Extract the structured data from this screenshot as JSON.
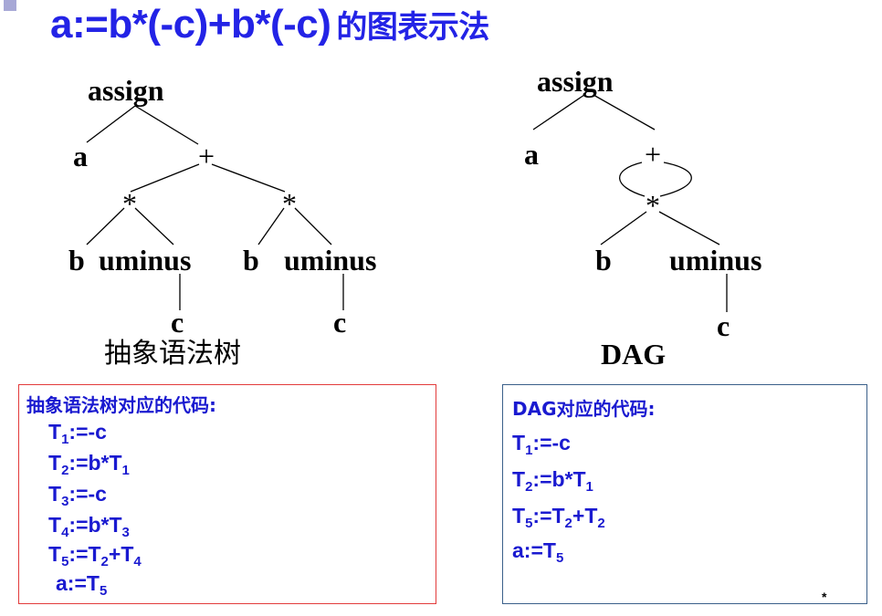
{
  "title": {
    "expr": "a:=b*(-c)+b*(-c)",
    "cn": "的图表示法"
  },
  "ast": {
    "root": "assign",
    "a": "a",
    "plus": "+",
    "star": "*",
    "b": "b",
    "uminus": "uminus",
    "c": "c",
    "caption": "抽象语法树"
  },
  "dag": {
    "root": "assign",
    "a": "a",
    "plus": "+",
    "star": "*",
    "b": "b",
    "uminus": "uminus",
    "c": "c",
    "caption": "DAG"
  },
  "ast_code": {
    "title": "抽象语法树对应的代码:",
    "lines": [
      {
        "pre": "T",
        "sub1": "1",
        "mid": ":=-c",
        "sub2": "",
        "post": "",
        "sub3": ""
      },
      {
        "pre": "T",
        "sub1": "2",
        "mid": ":=b*T",
        "sub2": "1",
        "post": "",
        "sub3": ""
      },
      {
        "pre": "T",
        "sub1": "3",
        "mid": ":=-c",
        "sub2": "",
        "post": "",
        "sub3": ""
      },
      {
        "pre": "T",
        "sub1": "4",
        "mid": ":=b*T",
        "sub2": "3",
        "post": "",
        "sub3": ""
      },
      {
        "pre": "T",
        "sub1": "5",
        "mid": ":=T",
        "sub2": "2",
        "post": "+T",
        "sub3": "4"
      },
      {
        "pre": "a:=T",
        "sub1": "5",
        "mid": "",
        "sub2": "",
        "post": "",
        "sub3": ""
      }
    ]
  },
  "dag_code": {
    "title": "DAG对应的代码:",
    "lines": [
      {
        "pre": "T",
        "sub1": "1",
        "mid": ":=-c",
        "sub2": "",
        "post": "",
        "sub3": ""
      },
      {
        "pre": "T",
        "sub1": "2",
        "mid": ":=b*T",
        "sub2": "1",
        "post": "",
        "sub3": ""
      },
      {
        "pre": "T",
        "sub1": "5",
        "mid": ":=T",
        "sub2": "2",
        "post": "+T",
        "sub3": "2"
      },
      {
        "pre": "a:=T",
        "sub1": "5",
        "mid": "",
        "sub2": "",
        "post": "",
        "sub3": ""
      }
    ]
  },
  "footer_mark": "*"
}
